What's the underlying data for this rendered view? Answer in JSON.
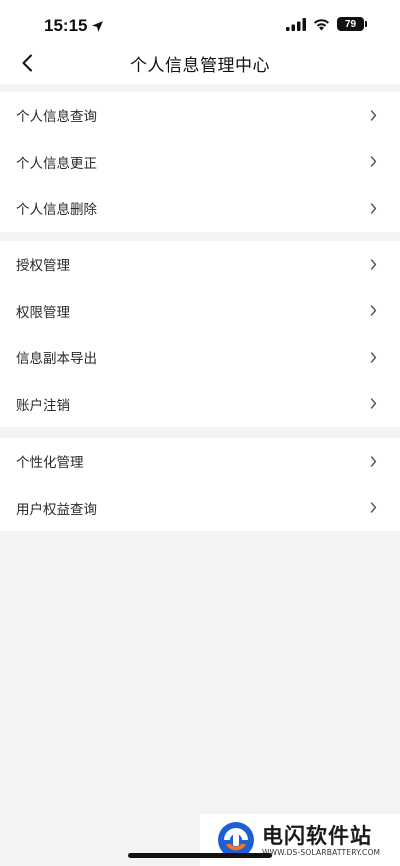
{
  "status_bar": {
    "time": "15:15",
    "battery": "79"
  },
  "header": {
    "title": "个人信息管理中心"
  },
  "groups": [
    {
      "items": [
        {
          "label": "个人信息查询"
        },
        {
          "label": "个人信息更正"
        },
        {
          "label": "个人信息删除"
        }
      ]
    },
    {
      "items": [
        {
          "label": "授权管理"
        },
        {
          "label": "权限管理"
        },
        {
          "label": "信息副本导出"
        },
        {
          "label": "账户注销"
        }
      ]
    },
    {
      "items": [
        {
          "label": "个性化管理"
        },
        {
          "label": "用户权益查询"
        }
      ]
    }
  ],
  "watermark": {
    "title": "电闪软件站",
    "url": "WWW.DS-SOLARBATTERY.COM"
  },
  "colors": {
    "background": "#f3f3f5",
    "card": "#ffffff",
    "text": "#222222",
    "chevron": "#555555",
    "logo_blue": "#1e5fd8",
    "logo_orange": "#f07a1a"
  }
}
